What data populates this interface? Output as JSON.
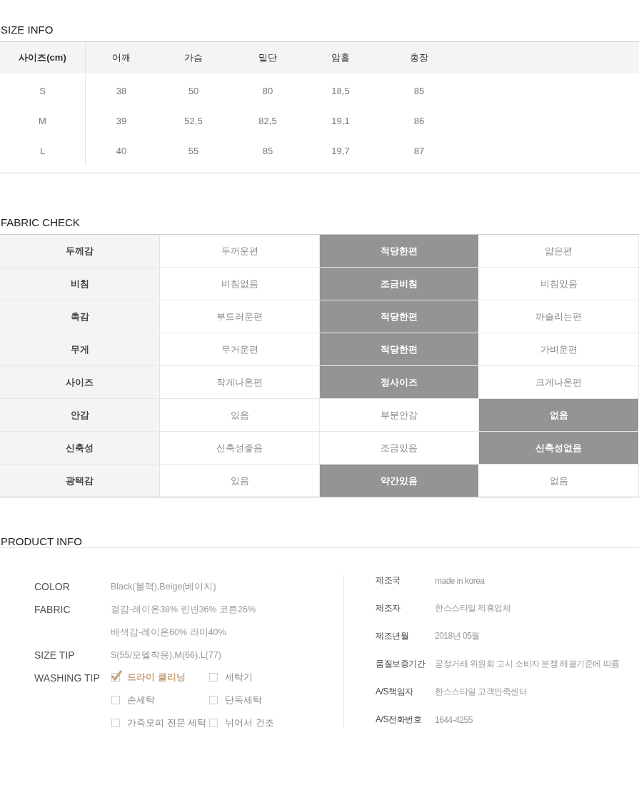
{
  "size_info": {
    "title": "SIZE INFO",
    "columns": [
      "사이즈(cm)",
      "어깨",
      "가슴",
      "밑단",
      "암홀",
      "총장"
    ],
    "rows": [
      {
        "cells": [
          "S",
          "38",
          "50",
          "80",
          "18,5",
          "85"
        ]
      },
      {
        "cells": [
          "M",
          "39",
          "52,5",
          "82,5",
          "19,1",
          "86"
        ]
      },
      {
        "cells": [
          "L",
          "40",
          "55",
          "85",
          "19,7",
          "87"
        ]
      }
    ]
  },
  "fabric_check": {
    "title": "FABRIC CHECK",
    "rows": [
      {
        "label": "두께감",
        "options": [
          {
            "text": "두꺼운편",
            "selected": false
          },
          {
            "text": "적당한편",
            "selected": true
          },
          {
            "text": "얇은편",
            "selected": false
          }
        ]
      },
      {
        "label": "비침",
        "options": [
          {
            "text": "비침없음",
            "selected": false
          },
          {
            "text": "조금비침",
            "selected": true
          },
          {
            "text": "비침있음",
            "selected": false
          }
        ]
      },
      {
        "label": "촉감",
        "options": [
          {
            "text": "부드러운편",
            "selected": false
          },
          {
            "text": "적당한편",
            "selected": true
          },
          {
            "text": "까슬리는편",
            "selected": false
          }
        ]
      },
      {
        "label": "무게",
        "options": [
          {
            "text": "무거운편",
            "selected": false
          },
          {
            "text": "적당한편",
            "selected": true
          },
          {
            "text": "가벼운편",
            "selected": false
          }
        ]
      },
      {
        "label": "사이즈",
        "options": [
          {
            "text": "작게나온편",
            "selected": false
          },
          {
            "text": "정사이즈",
            "selected": true
          },
          {
            "text": "크게나온편",
            "selected": false
          }
        ]
      },
      {
        "label": "안감",
        "options": [
          {
            "text": "있음",
            "selected": false
          },
          {
            "text": "부분안감",
            "selected": false
          },
          {
            "text": "없음",
            "selected": true
          }
        ]
      },
      {
        "label": "신축성",
        "options": [
          {
            "text": "신축성좋음",
            "selected": false
          },
          {
            "text": "조금있음",
            "selected": false
          },
          {
            "text": "신축성없음",
            "selected": true
          }
        ]
      },
      {
        "label": "광택감",
        "options": [
          {
            "text": "있음",
            "selected": false
          },
          {
            "text": "약간있음",
            "selected": true
          },
          {
            "text": "없음",
            "selected": false
          }
        ]
      }
    ]
  },
  "product_info": {
    "title": "PRODUCT INFO",
    "details": [
      {
        "label": "COLOR",
        "values": [
          "Black(블랙),Beige(베이지)"
        ]
      },
      {
        "label": "FABRIC",
        "values": [
          "겉감-레이온38% 린넨36% 코튼26%",
          "배색감-레이온60% 라미40%"
        ]
      },
      {
        "label": "SIZE TIP",
        "values": [
          "S(55/모델착용),M(66),L(77)"
        ]
      }
    ],
    "washing": {
      "label": "WASHING TIP",
      "options": [
        {
          "text": "드라이 클리닝",
          "checked": true
        },
        {
          "text": "세탁기",
          "checked": false
        },
        {
          "text": "손세탁",
          "checked": false
        },
        {
          "text": "단독세탁",
          "checked": false
        },
        {
          "text": "가죽모피 전문 세탁",
          "checked": false
        },
        {
          "text": "뉘어서 건조",
          "checked": false
        }
      ]
    },
    "manufacturer": [
      {
        "label": "제조국",
        "value": "made in korea"
      },
      {
        "label": "제조자",
        "value": "한스스타일 제휴업체"
      },
      {
        "label": "제조년월",
        "value": "2018년 05월"
      },
      {
        "label": "품질보증기간",
        "value": "공정거래 위원회 고시 소비자 분쟁 해결기준에 따름"
      },
      {
        "label": "A/S책임자",
        "value": "한스스타일 고객만족센터"
      },
      {
        "label": "A/S전화번호",
        "value": "1644-4255"
      }
    ]
  }
}
